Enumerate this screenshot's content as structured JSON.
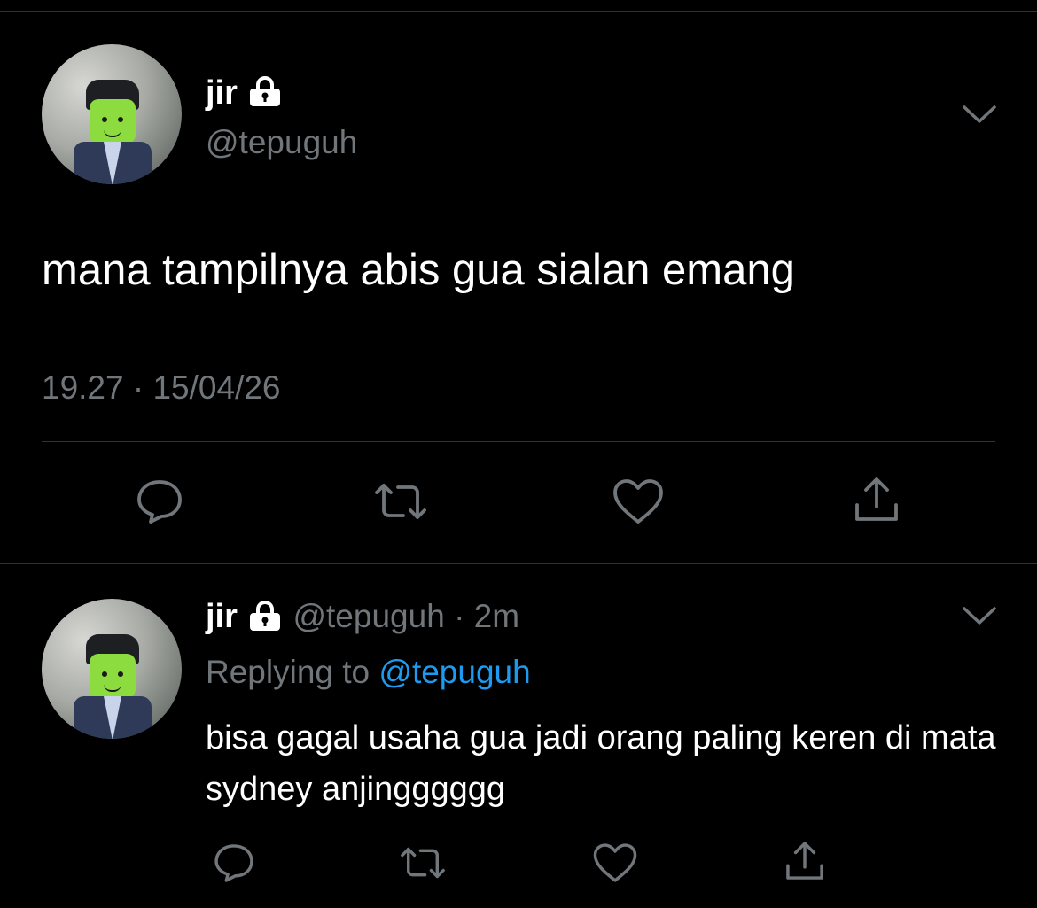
{
  "main_tweet": {
    "name": "jir",
    "handle": "@tepuguh",
    "text": "mana tampilnya abis gua sialan emang",
    "time": "19.27",
    "separator": "·",
    "date": "15/04/26"
  },
  "reply_tweet": {
    "name": "jir",
    "handle": "@tepuguh",
    "separator": "·",
    "age": "2m",
    "replying_prefix": "Replying to",
    "replying_handle": "@tepuguh",
    "text": "bisa gagal usaha gua jadi orang paling keren di mata sydney anjingggggg"
  },
  "icons": {
    "verified_lock": "lock-icon",
    "menu": "chevron-down-icon",
    "actions": [
      "reply-icon",
      "retweet-icon",
      "like-icon",
      "share-icon"
    ]
  },
  "colors": {
    "background": "#000000",
    "text": "#ffffff",
    "secondary": "#71767b",
    "link": "#1d9bf0",
    "divider": "#2f3336"
  }
}
